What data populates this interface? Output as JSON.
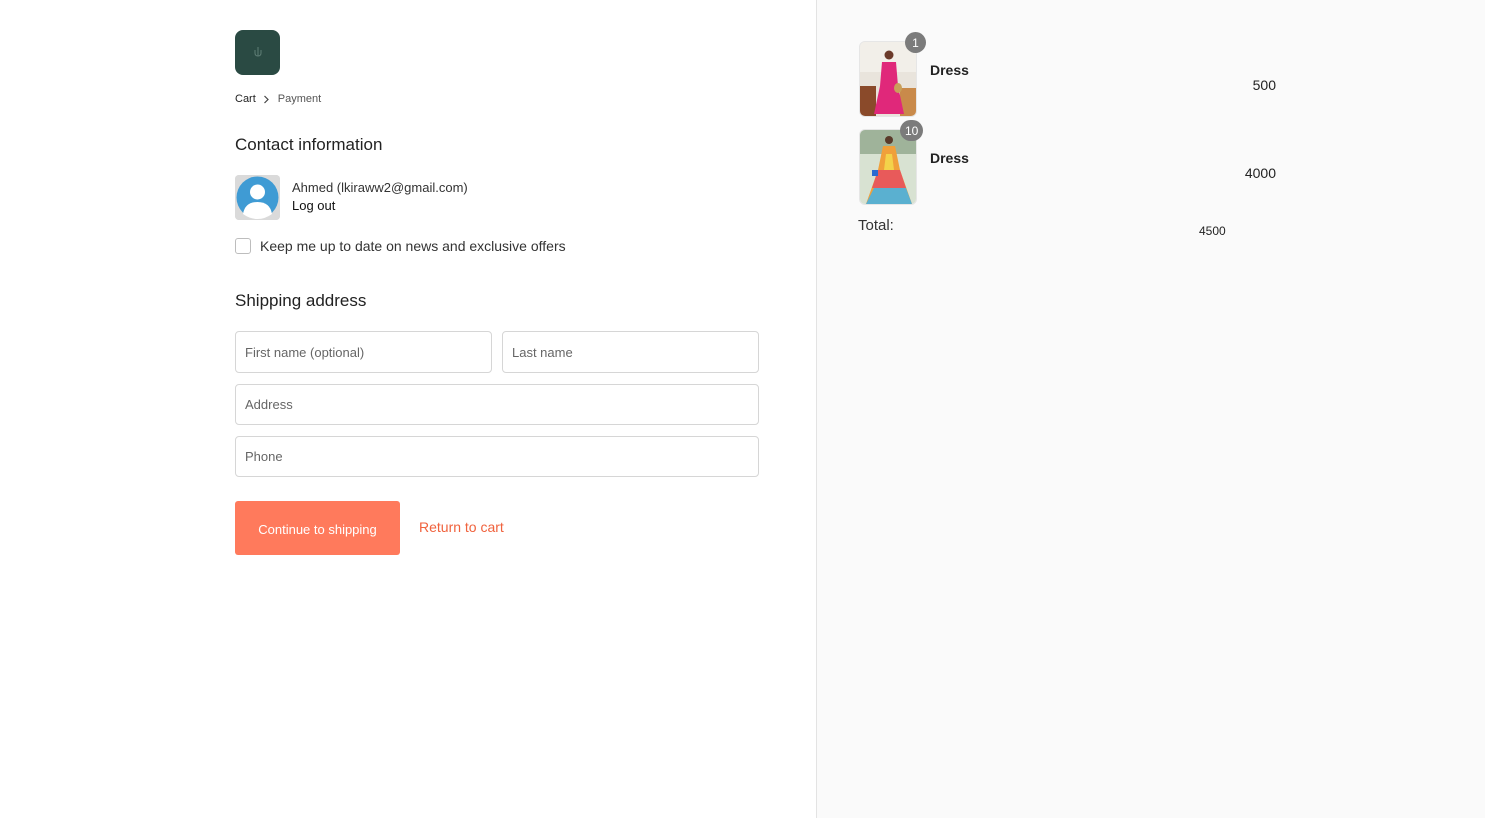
{
  "header": {
    "breadcrumb": {
      "cart": "Cart",
      "current": "Payment"
    }
  },
  "contact": {
    "title": "Contact information",
    "user": "Ahmed (lkiraww2@gmail.com)",
    "logout": "Log out",
    "newsletter_label": "Keep me up to date on news and exclusive offers",
    "newsletter_checked": false
  },
  "shipping": {
    "title": "Shipping address",
    "first_name_placeholder": "First name (optional)",
    "last_name_placeholder": "Last name",
    "address_placeholder": "Address",
    "phone_placeholder": "Phone"
  },
  "actions": {
    "continue_label": "Continue to shipping",
    "return_label": "Return to cart"
  },
  "cart": {
    "items": [
      {
        "name": "Dress",
        "quantity": "1",
        "price": "500"
      },
      {
        "name": "Dress",
        "quantity": "10",
        "price": "4000"
      }
    ],
    "total_label": "Total:",
    "total_value": "4500"
  },
  "colors": {
    "logo_bg": "#2a4a43",
    "accent": "#ff7a5c",
    "link": "#f0623d",
    "badge": "#7b7b7b"
  },
  "icons": [
    "logo-icon",
    "chevron-right-icon",
    "avatar-icon",
    "checkbox-icon"
  ]
}
